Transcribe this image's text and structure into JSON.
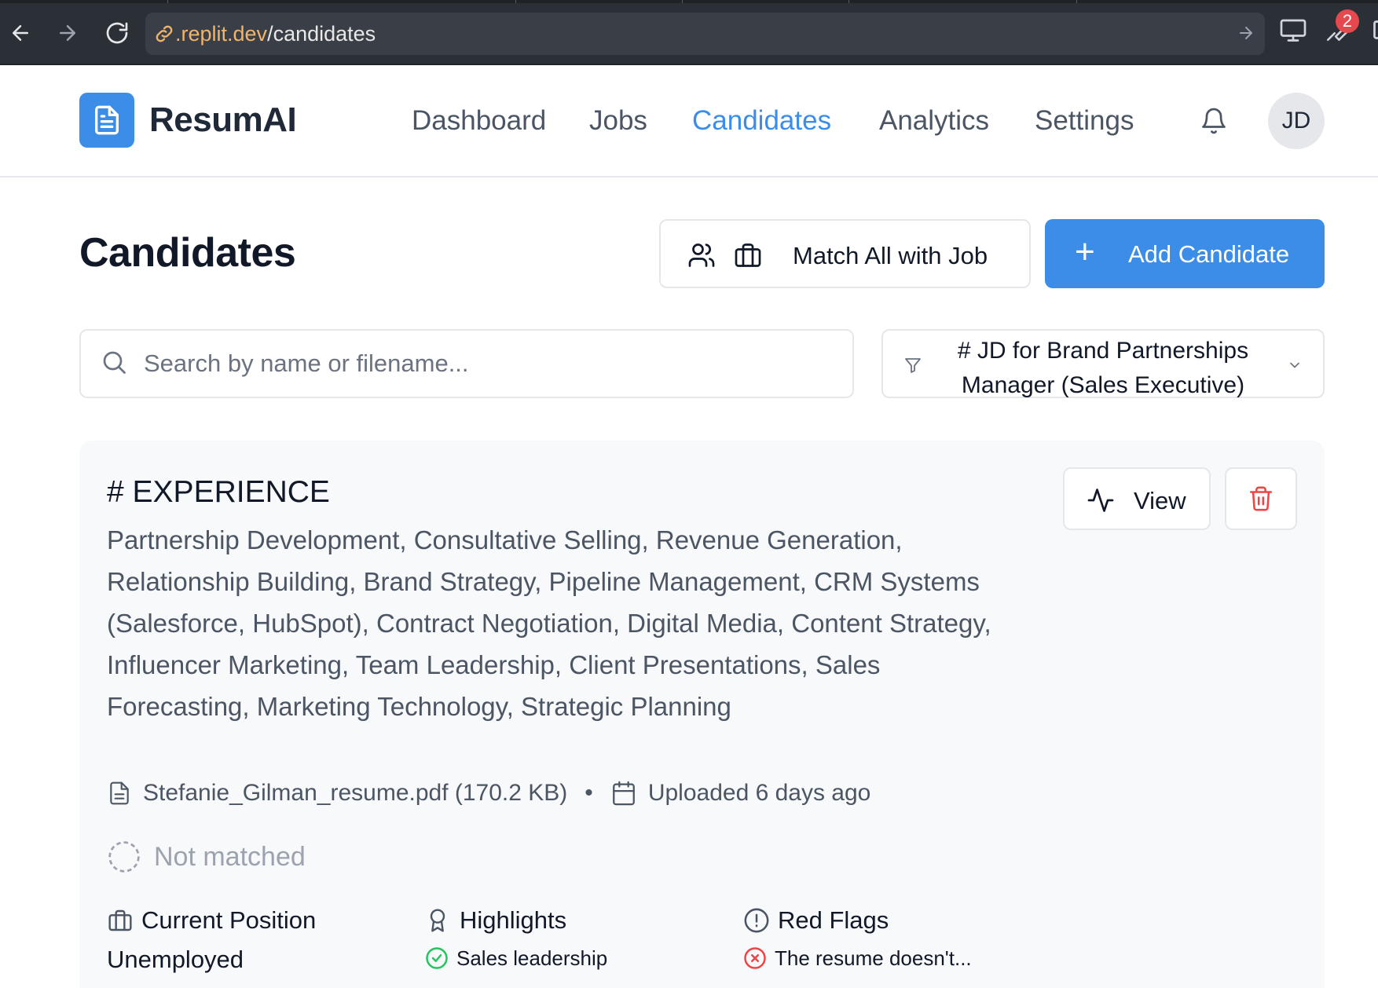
{
  "browser": {
    "url_host": ".replit.dev",
    "url_path": "/candidates",
    "badge_count": "2"
  },
  "header": {
    "logo_text": "ResumAI",
    "nav": {
      "dashboard": "Dashboard",
      "jobs": "Jobs",
      "candidates": "Candidates",
      "analytics": "Analytics",
      "settings": "Settings"
    },
    "active_nav": "Candidates",
    "avatar_initials": "JD"
  },
  "page": {
    "title": "Candidates",
    "match_all_label": "Match All with Job",
    "add_candidate_label": "Add Candidate"
  },
  "search": {
    "placeholder": "Search by name or filename...",
    "value": ""
  },
  "filter": {
    "selected": "# JD for Brand Partnerships Manager (Sales Executive)"
  },
  "card": {
    "title": "# EXPERIENCE",
    "description": "Partnership Development, Consultative Selling, Revenue Generation, Relationship Building, Brand Strategy, Pipeline Management, CRM Systems (Salesforce, HubSpot), Contract Negotiation, Digital Media, Content Strategy, Influencer Marketing, Team Leadership, Client Presentations, Sales Forecasting, Marketing Technology, Strategic Planning",
    "view_label": "View",
    "file_name": "Stefanie_Gilman_resume.pdf (170.2 KB)",
    "separator": "•",
    "uploaded": "Uploaded 6 days ago",
    "match_status": "Not matched",
    "current_position": {
      "heading": "Current Position",
      "value": "Unemployed"
    },
    "highlights": {
      "heading": "Highlights",
      "items": [
        "Sales leadership"
      ]
    },
    "red_flags": {
      "heading": "Red Flags",
      "items": [
        "The resume doesn't..."
      ]
    }
  },
  "colors": {
    "accent": "#3b8de8",
    "success": "#22c55e",
    "danger": "#ef4444",
    "muted": "#9ca3af"
  }
}
